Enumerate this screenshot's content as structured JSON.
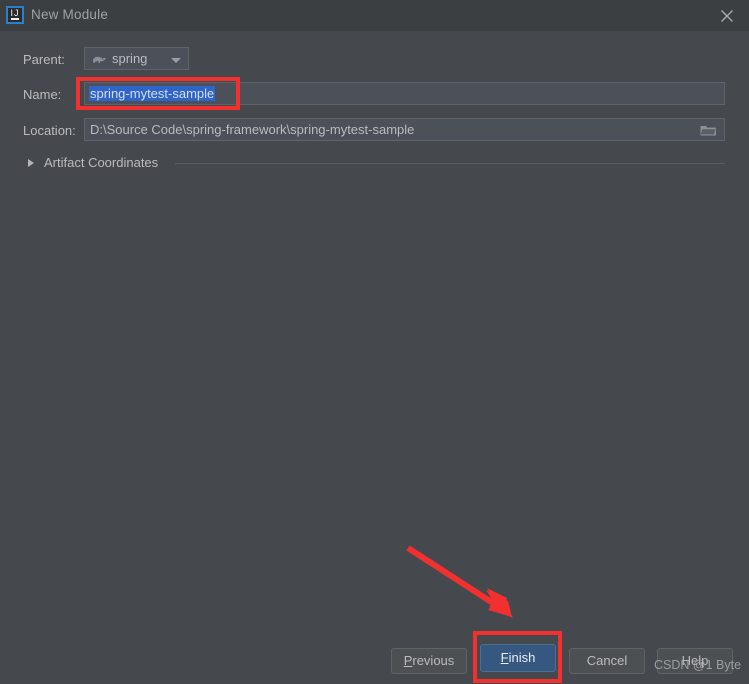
{
  "window": {
    "title": "New Module",
    "app_icon": "intellij-idea-icon",
    "icon_letters": "IJ",
    "close_icon": "close-icon"
  },
  "form": {
    "parent": {
      "label": "Parent:",
      "value": "spring",
      "icon": "maven-module-icon",
      "dropdown_icon": "chevron-down-icon"
    },
    "name": {
      "label": "Name:",
      "value": "spring-mytest-sample",
      "selected": true
    },
    "location": {
      "label": "Location:",
      "value": "D:\\Source Code\\spring-framework\\spring-mytest-sample",
      "browse_icon": "folder-icon"
    },
    "artifact_coordinates": {
      "label": "Artifact Coordinates",
      "expanded": false,
      "expander_icon": "triangle-right-icon"
    }
  },
  "buttons": {
    "previous": {
      "label": "Previous",
      "mnemonic": "P"
    },
    "finish": {
      "label": "Finish",
      "mnemonic": "F",
      "primary": true
    },
    "cancel": {
      "label": "Cancel"
    },
    "help": {
      "label": "Help"
    }
  },
  "annotations": {
    "name_highlight": "red-rectangle-around-name-field",
    "finish_highlight": "red-rectangle-around-finish-button",
    "arrow": "red-arrow-pointing-to-finish-button"
  },
  "watermark": {
    "text": "CSDN @1 Byte"
  },
  "colors": {
    "dialog_bg": "#45494d",
    "titlebar_bg": "#3c3f41",
    "field_bg": "#4b5059",
    "text": "#bbbbbb",
    "selection": "#2f65ca",
    "primary_button": "#365880",
    "annotation_red": "#f23030"
  }
}
